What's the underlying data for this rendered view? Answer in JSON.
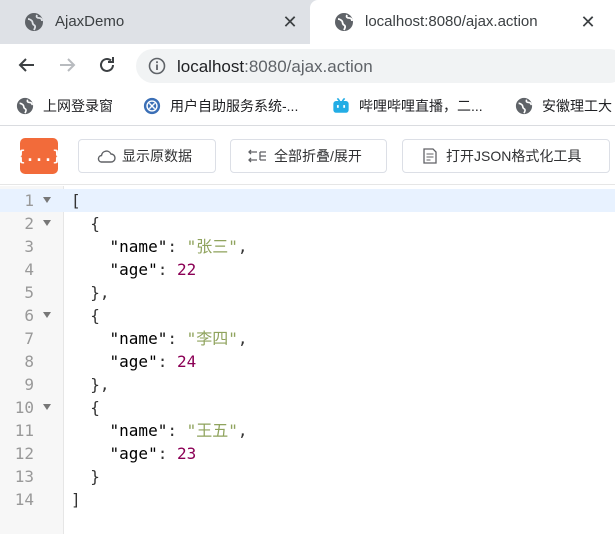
{
  "tabs": [
    {
      "title": "AjaxDemo",
      "active": false
    },
    {
      "title": "localhost:8080/ajax.action",
      "active": true
    }
  ],
  "close_glyph": "✕",
  "address": {
    "host": "localhost",
    "rest": ":8080/ajax.action"
  },
  "bookmarks": [
    {
      "label": "上网登录窗",
      "icon": "globe-icon"
    },
    {
      "label": "用户自助服务系统-...",
      "icon": "self-service-icon"
    },
    {
      "label": "哔哩哔哩直播，二...",
      "icon": "bilibili-icon"
    },
    {
      "label": "安徽理工大",
      "icon": "globe-icon"
    }
  ],
  "extension": {
    "logo_text": "{...}",
    "buttons": [
      {
        "label": "显示原数据",
        "icon": "cloud-icon"
      },
      {
        "label": "全部折叠/展开",
        "icon": "collapse-icon"
      },
      {
        "label": "打开JSON格式化工具",
        "icon": "json-file-icon"
      }
    ]
  },
  "code": {
    "lines": [
      {
        "n": "1",
        "fold": true,
        "text": "["
      },
      {
        "n": "2",
        "fold": true,
        "text": "  {"
      },
      {
        "n": "3",
        "fold": false,
        "indent": "    ",
        "key": "\"name\"",
        "sep": ": ",
        "value": "\"张三\"",
        "vtype": "str",
        "tail": ","
      },
      {
        "n": "4",
        "fold": false,
        "indent": "    ",
        "key": "\"age\"",
        "sep": ": ",
        "value": "22",
        "vtype": "num",
        "tail": ""
      },
      {
        "n": "5",
        "fold": false,
        "text": "  },"
      },
      {
        "n": "6",
        "fold": true,
        "text": "  {"
      },
      {
        "n": "7",
        "fold": false,
        "indent": "    ",
        "key": "\"name\"",
        "sep": ": ",
        "value": "\"李四\"",
        "vtype": "str",
        "tail": ","
      },
      {
        "n": "8",
        "fold": false,
        "indent": "    ",
        "key": "\"age\"",
        "sep": ": ",
        "value": "24",
        "vtype": "num",
        "tail": ""
      },
      {
        "n": "9",
        "fold": false,
        "text": "  },"
      },
      {
        "n": "10",
        "fold": true,
        "text": "  {"
      },
      {
        "n": "11",
        "fold": false,
        "indent": "    ",
        "key": "\"name\"",
        "sep": ": ",
        "value": "\"王五\"",
        "vtype": "str",
        "tail": ","
      },
      {
        "n": "12",
        "fold": false,
        "indent": "    ",
        "key": "\"age\"",
        "sep": ": ",
        "value": "23",
        "vtype": "num",
        "tail": ""
      },
      {
        "n": "13",
        "fold": false,
        "text": "  }"
      },
      {
        "n": "14",
        "fold": false,
        "text": "]"
      }
    ]
  },
  "colors": {
    "accent": "#f26b3a",
    "string": "#8fa35d",
    "number": "#8b0055",
    "highlight": "#e8f2ff"
  }
}
